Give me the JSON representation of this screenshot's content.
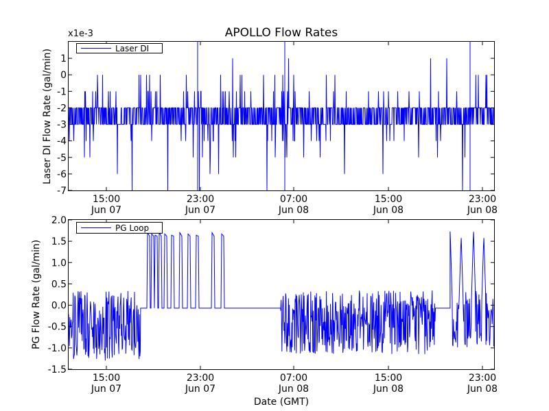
{
  "figure": {
    "title": "APOLLO Flow Rates",
    "xlabel": "Date (GMT)"
  },
  "chart_data": [
    {
      "type": "line",
      "ylabel": "Laser DI Flow Rate (gal/min)",
      "offset_label": "x1e-3",
      "ylim": [
        -7,
        2
      ],
      "yticks": [
        1,
        0,
        -1,
        -2,
        -3,
        -4,
        -5,
        -6,
        -7
      ],
      "ytick_labels": [
        "1",
        "0",
        "-1",
        "-2",
        "-3",
        "-4",
        "-5",
        "-6",
        "-7"
      ],
      "xlim_hours": [
        10.8,
        23.8
      ],
      "xticks": [
        {
          "time": "15:00",
          "date": "Jun 07"
        },
        {
          "time": "23:00",
          "date": "Jun 07"
        },
        {
          "time": "07:00",
          "date": "Jun 08"
        },
        {
          "time": "15:00",
          "date": "Jun 08"
        },
        {
          "time": "23:00",
          "date": "Jun 08"
        }
      ],
      "legend": {
        "label": "Laser DI",
        "placement": "top-left"
      },
      "color": "#0000ff",
      "series": [
        {
          "name": "Laser DI",
          "description_units": "1e-3 gal/min",
          "typical_band": [
            -3,
            -2
          ],
          "spike_range": [
            -7,
            2
          ]
        }
      ],
      "grid": false
    },
    {
      "type": "line",
      "ylabel": "PG Flow Rate (gal/min)",
      "ylim": [
        -1.5,
        2.0
      ],
      "yticks": [
        2.0,
        1.5,
        1.0,
        0.5,
        0.0,
        -0.5,
        -1.0,
        -1.5
      ],
      "ytick_labels": [
        "2.0",
        "1.5",
        "1.0",
        "0.5",
        "0.0",
        "-0.5",
        "-1.0",
        "-1.5"
      ],
      "xticks": [
        {
          "time": "15:00",
          "date": "Jun 07"
        },
        {
          "time": "23:00",
          "date": "Jun 07"
        },
        {
          "time": "07:00",
          "date": "Jun 08"
        },
        {
          "time": "15:00",
          "date": "Jun 08"
        },
        {
          "time": "23:00",
          "date": "Jun 08"
        }
      ],
      "legend": {
        "label": "PG Loop",
        "placement": "top-left"
      },
      "color": "#0000ff",
      "series": [
        {
          "name": "PG Loop",
          "segments": [
            {
              "from": "Jun 07 11:15",
              "to": "Jun 07 17:55",
              "pattern": "noise",
              "min": -1.2,
              "max": 0.45
            },
            {
              "from": "Jun 07 17:55",
              "to": "Jun 08 05:50",
              "pattern": "baseline_with_pulses",
              "baseline": -0.07,
              "pulse_peak": 1.7
            },
            {
              "from": "Jun 08 05:50",
              "to": "Jun 08 19:00",
              "pattern": "noise",
              "min": -1.05,
              "max": 0.45
            },
            {
              "from": "Jun 08 19:00",
              "to": "Jun 08 20:15",
              "pattern": "baseline",
              "baseline": -0.07
            },
            {
              "from": "Jun 08 20:15",
              "to": "Jun 09 00:00",
              "pattern": "noise_with_pulses",
              "min": -0.9,
              "max": 1.78
            }
          ]
        }
      ],
      "grid": false
    }
  ]
}
